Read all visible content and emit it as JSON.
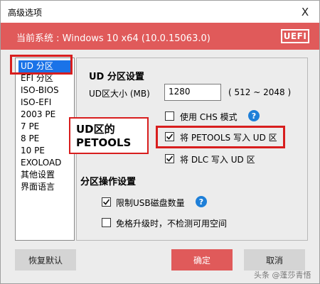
{
  "window": {
    "title": "高级选项",
    "close_glyph": "X"
  },
  "banner": {
    "system_label": "当前系统 : Windows 10 x64 (10.0.15063.0)",
    "badge": "UEFI",
    "color": "#e05a5a"
  },
  "sidebar": {
    "items": [
      {
        "label": "UD 分区"
      },
      {
        "label": "EFI 分区"
      },
      {
        "label": "ISO-BIOS"
      },
      {
        "label": "ISO-EFI"
      },
      {
        "label": "2003 PE"
      },
      {
        "label": "7 PE"
      },
      {
        "label": "8 PE"
      },
      {
        "label": "10 PE"
      },
      {
        "label": "EXOLOAD"
      },
      {
        "label": "其他设置"
      },
      {
        "label": "界面语言"
      }
    ],
    "selected_color": "#1a73e8"
  },
  "ud_settings": {
    "title": "UD 分区设置",
    "size_label": "UD区大小 (MB)",
    "size_value": "1280",
    "size_range": "( 512 ~ 2048 )",
    "chs_label": "使用 CHS 模式",
    "chs_checked": false,
    "petools_label": "将 PETOOLS 写入 UD 区",
    "petools_checked": true,
    "dlc_label": "将 DLC 写入 UD 区",
    "dlc_checked": true
  },
  "partition_ops": {
    "title": "分区操作设置",
    "usb_limit_label": "限制USB磁盘数量",
    "usb_limit_checked": true,
    "skip_check_label": "免格升级时，不检测可用空间",
    "skip_check_checked": false
  },
  "annotation": {
    "line1": "UD区的",
    "line2": "PETOOLS"
  },
  "buttons": {
    "reset": "恢复默认",
    "ok": "确定",
    "cancel": "取消"
  },
  "watermark": "头条 @蓬莎青悟",
  "help_glyph": "?"
}
